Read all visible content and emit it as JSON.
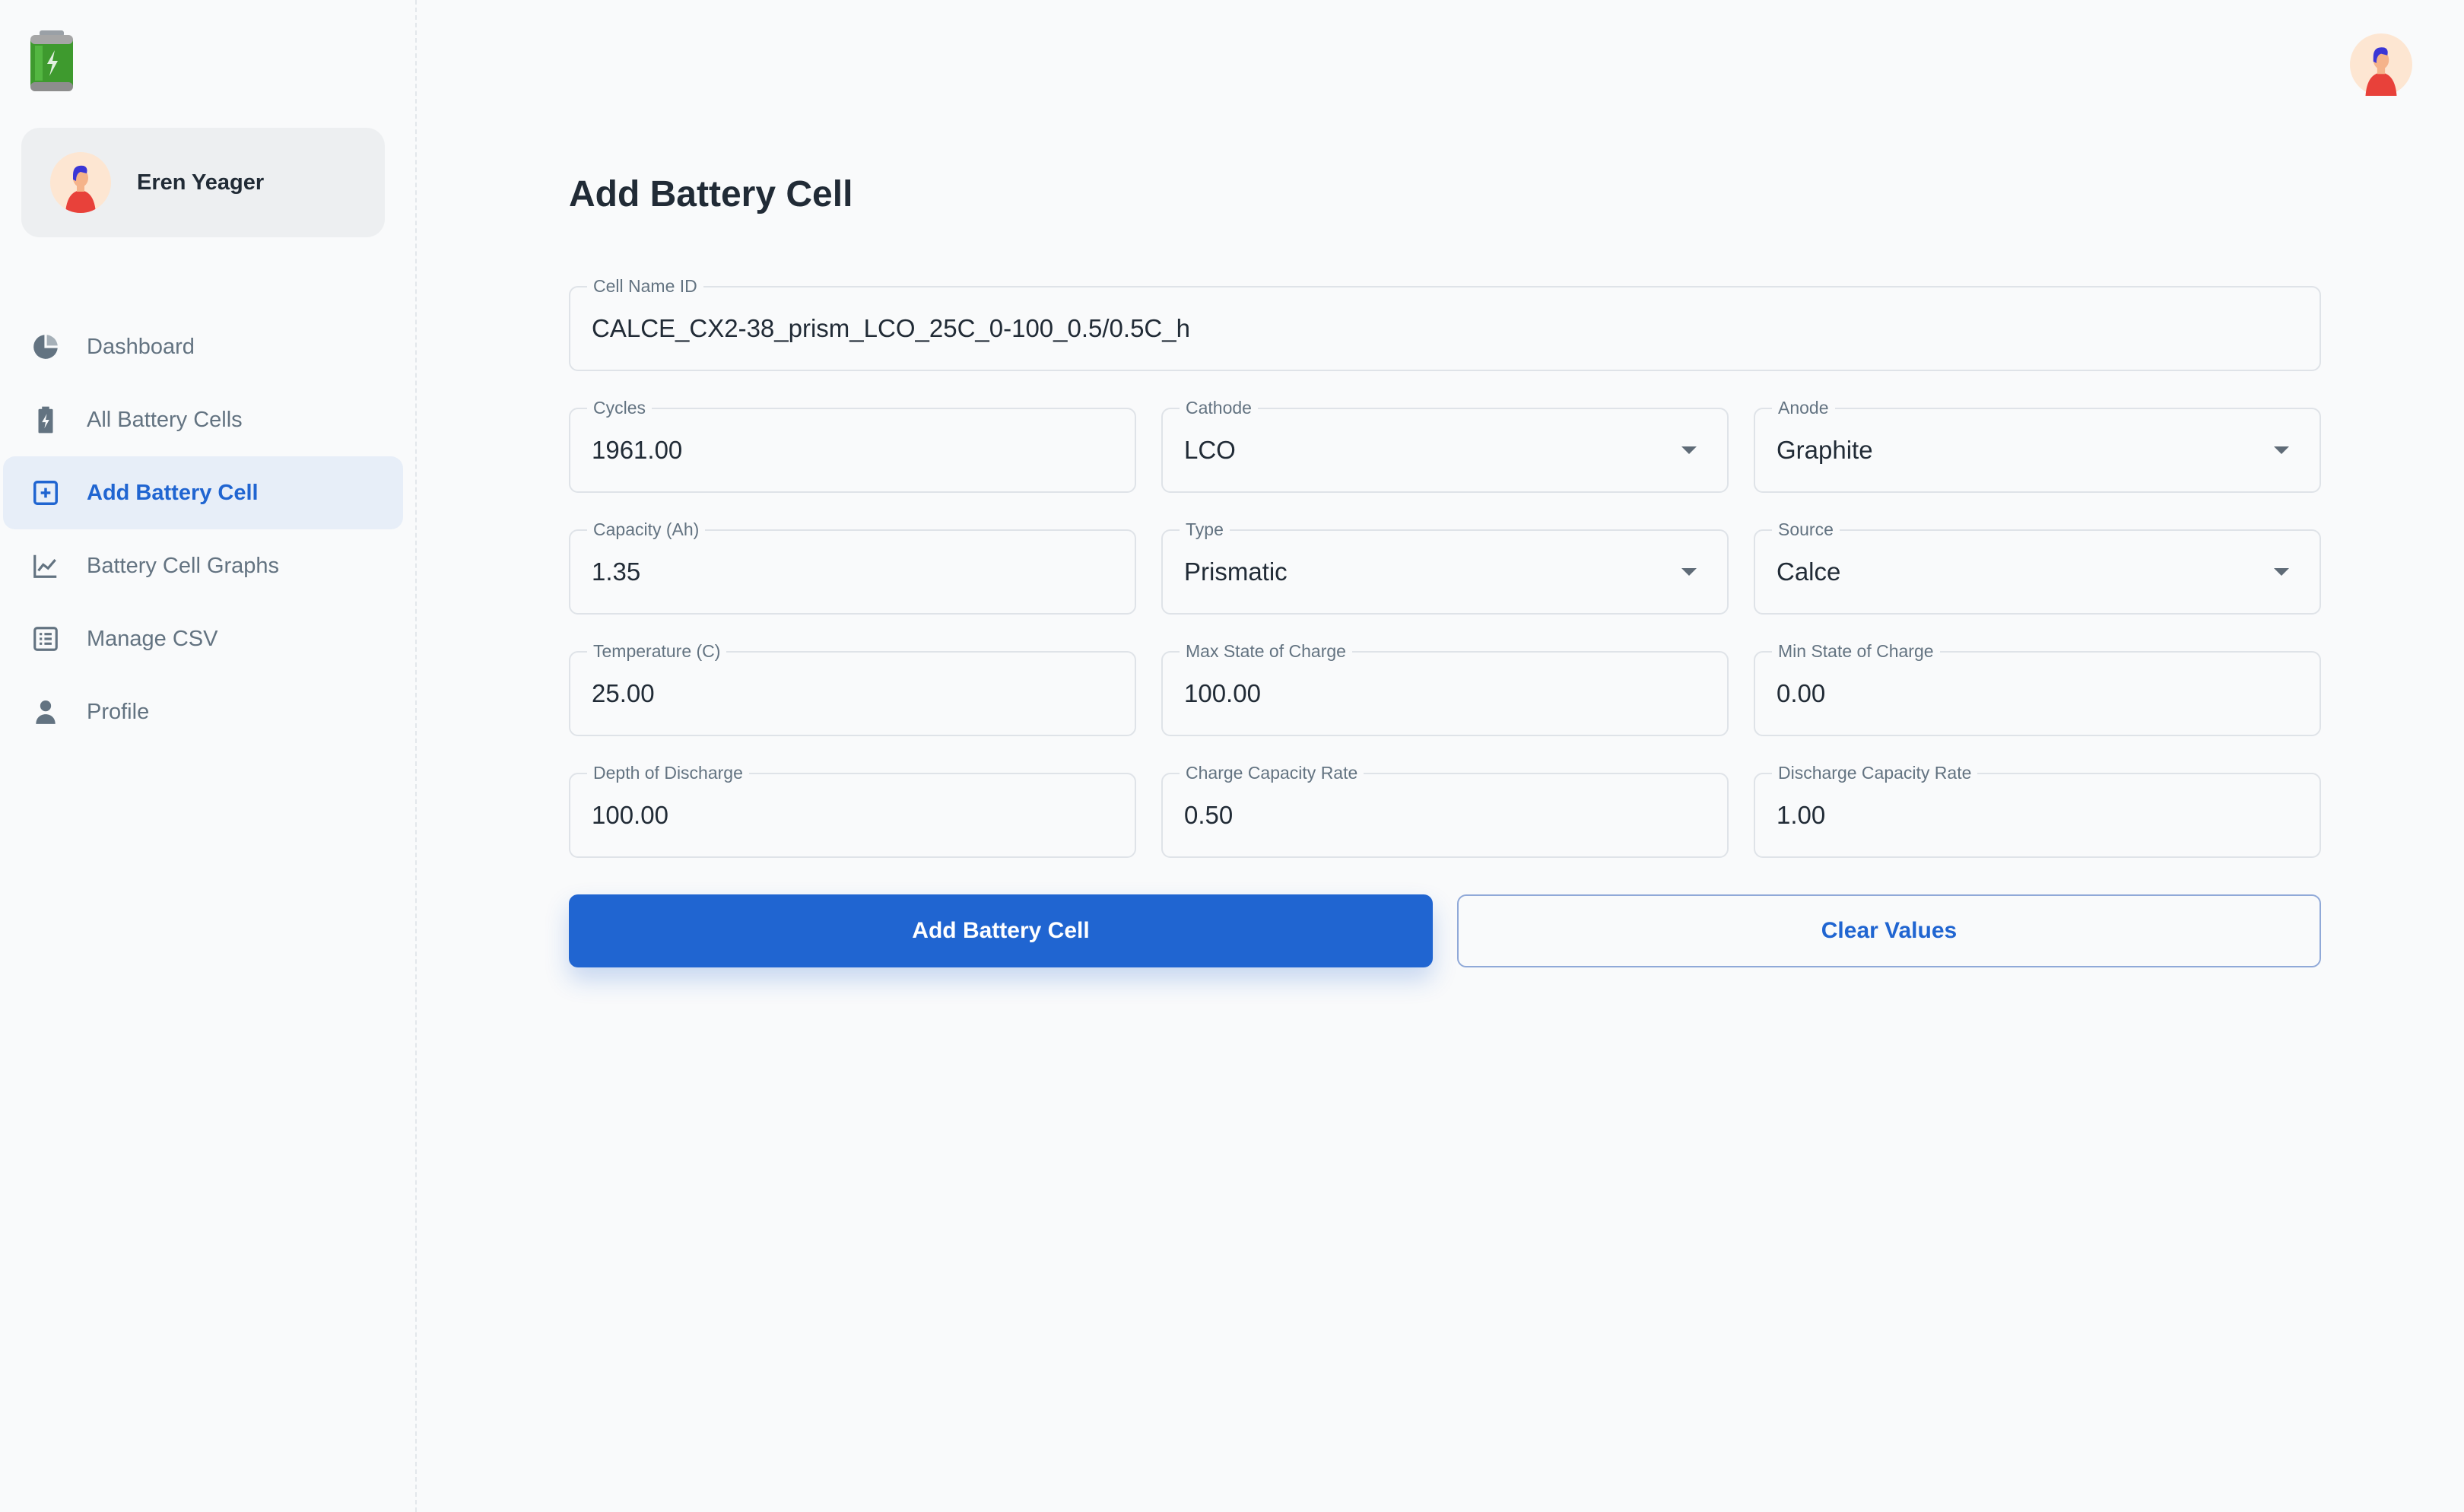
{
  "sidebar": {
    "logo_icon": "battery-logo-icon",
    "account": {
      "name": "Eren Yeager"
    },
    "nav": [
      {
        "label": "Dashboard",
        "icon": "pie-chart-icon",
        "active": false
      },
      {
        "label": "All Battery Cells",
        "icon": "battery-charging-icon",
        "active": false
      },
      {
        "label": "Add Battery Cell",
        "icon": "plus-square-icon",
        "active": true
      },
      {
        "label": "Battery Cell Graphs",
        "icon": "line-chart-icon",
        "active": false
      },
      {
        "label": "Manage CSV",
        "icon": "list-icon",
        "active": false
      },
      {
        "label": "Profile",
        "icon": "person-icon",
        "active": false
      }
    ]
  },
  "page": {
    "title": "Add Battery Cell"
  },
  "form": {
    "cell_name": {
      "label": "Cell Name ID",
      "value": "CALCE_CX2-38_prism_LCO_25C_0-100_0.5/0.5C_h"
    },
    "cycles": {
      "label": "Cycles",
      "value": "1961.00"
    },
    "cathode": {
      "label": "Cathode",
      "value": "LCO"
    },
    "anode": {
      "label": "Anode",
      "value": "Graphite"
    },
    "capacity": {
      "label": "Capacity (Ah)",
      "value": "1.35"
    },
    "type": {
      "label": "Type",
      "value": "Prismatic"
    },
    "source": {
      "label": "Source",
      "value": "Calce"
    },
    "temperature": {
      "label": "Temperature (C)",
      "value": "25.00"
    },
    "max_soc": {
      "label": "Max State of Charge",
      "value": "100.00"
    },
    "min_soc": {
      "label": "Min State of Charge",
      "value": "0.00"
    },
    "dod": {
      "label": "Depth of Discharge",
      "value": "100.00"
    },
    "charge_rate": {
      "label": "Charge Capacity Rate",
      "value": "0.50"
    },
    "discharge_rate": {
      "label": "Discharge Capacity Rate",
      "value": "1.00"
    }
  },
  "buttons": {
    "submit": "Add Battery Cell",
    "clear": "Clear Values"
  },
  "colors": {
    "primary": "#2065d1",
    "active_bg": "#e7eef8",
    "text": "#212b36",
    "muted": "#637381"
  }
}
